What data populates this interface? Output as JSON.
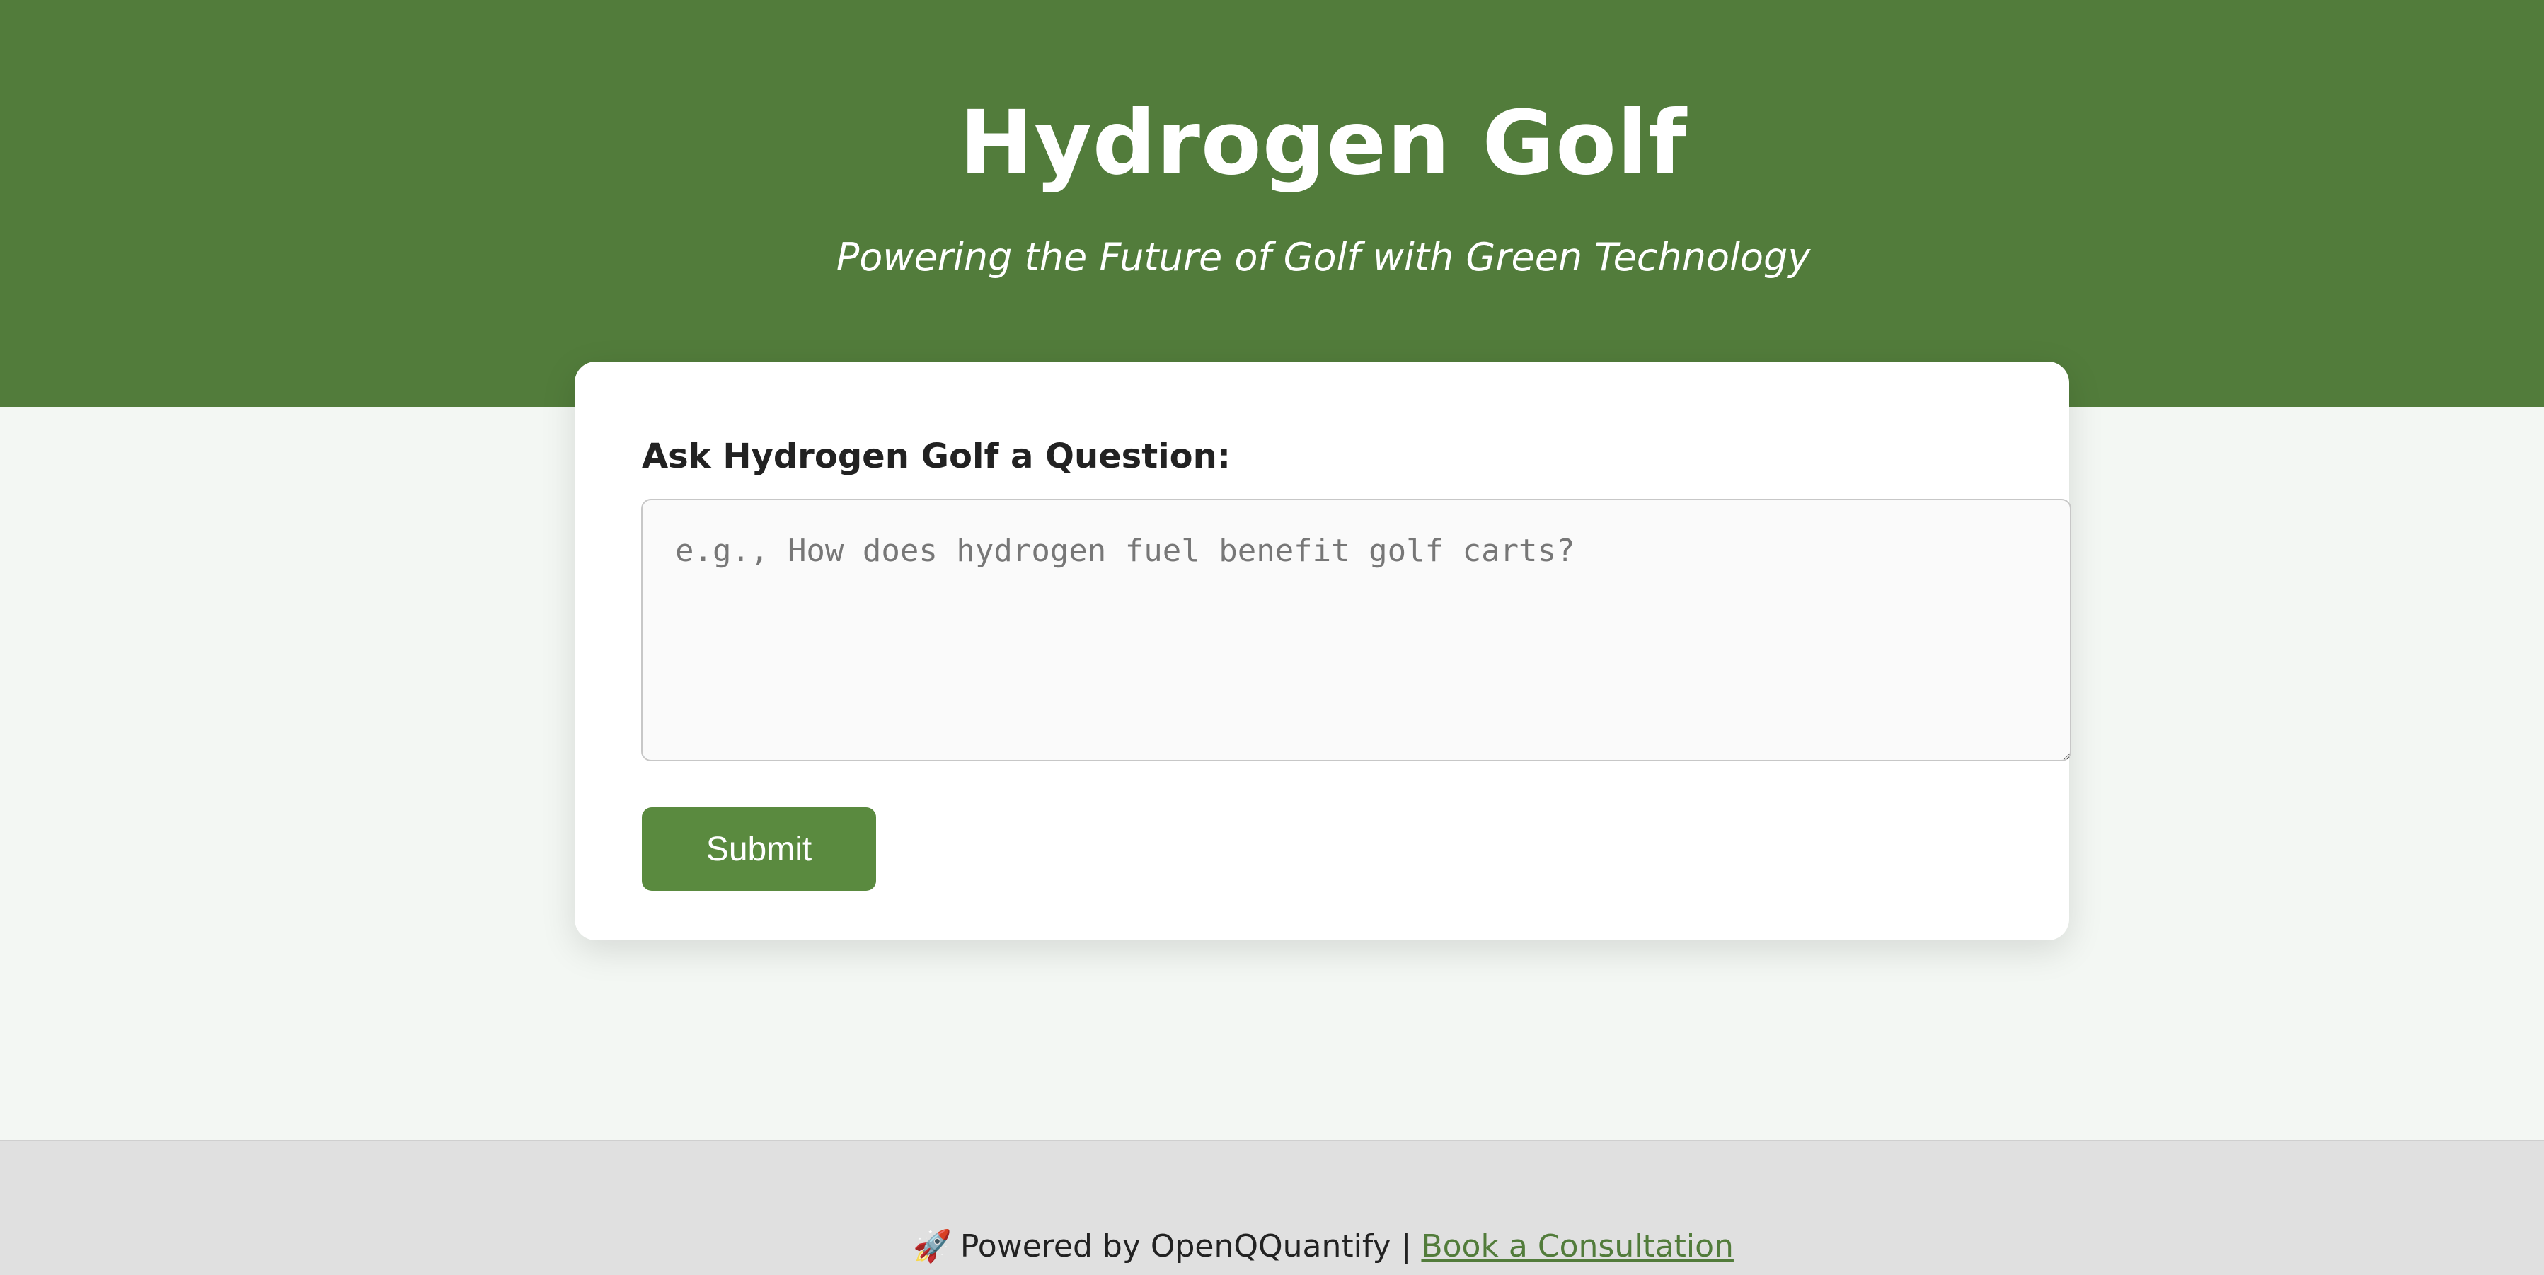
{
  "header": {
    "title": "Hydrogen Golf",
    "subtitle": "Powering the Future of Golf with Green Technology"
  },
  "form": {
    "label": "Ask Hydrogen Golf a Question:",
    "input_value": "",
    "input_placeholder": "e.g., How does hydrogen fuel benefit golf carts?",
    "submit_label": "Submit"
  },
  "footer": {
    "icon": "rocket-icon",
    "icon_glyph": "🚀",
    "powered_text": "Powered by OpenQQuantify",
    "separator": "|",
    "link_label": "Book a Consultation"
  },
  "colors": {
    "header_bg": "#527c3b",
    "button_bg": "#5a8a3f",
    "page_bg": "#f3f7f3",
    "footer_bg": "#e0e0e0",
    "link": "#527c3b"
  }
}
